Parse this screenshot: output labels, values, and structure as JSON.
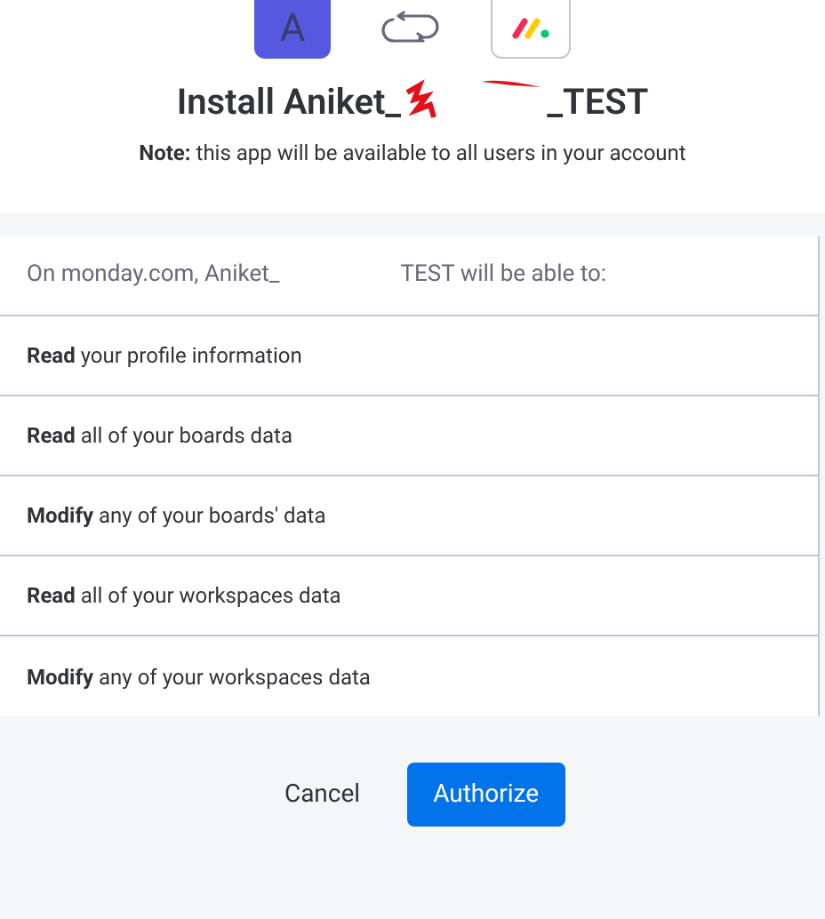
{
  "header": {
    "app_letter": "A",
    "title_start": "Install Aniket_",
    "title_end": "_TEST",
    "note": "**Note:** this app will be available to all users in your account"
  },
  "permissions": {
    "intro_start": "On monday.com, Aniket_",
    "intro_end": "TEST will be able to:",
    "items": [
      "**Read** your profile information",
      "**Read** all of your boards data",
      "**Modify** any of your boards' data",
      "**Read** all of your workspaces data",
      "**Modify** any of your workspaces data"
    ]
  },
  "buttons": {
    "cancel": "Cancel",
    "authorize": "Authorize"
  }
}
